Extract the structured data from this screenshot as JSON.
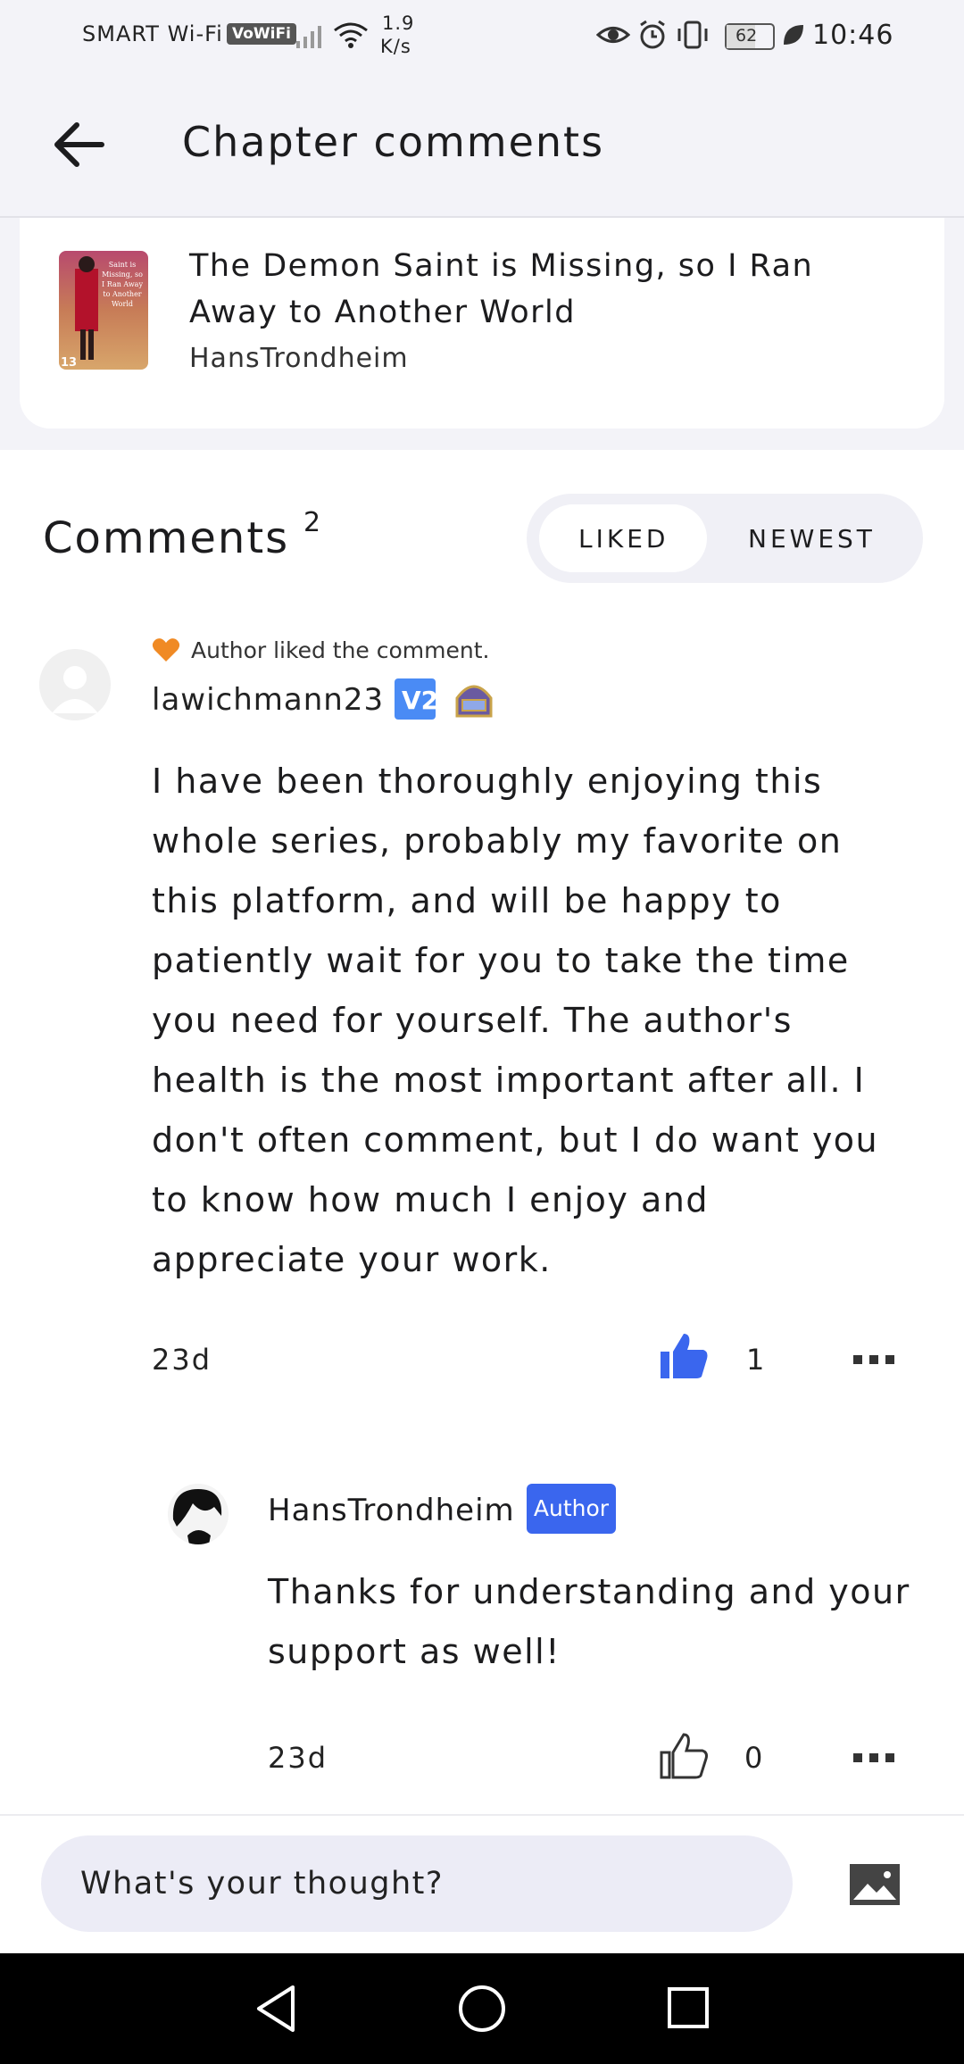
{
  "status_bar": {
    "carrier": "SMART Wi-Fi",
    "vowifi": "VoWiFi",
    "speed_value": "1.9",
    "speed_unit": "K/s",
    "battery": "62",
    "time": "10:46"
  },
  "header": {
    "title": "Chapter comments"
  },
  "book": {
    "title": "The Demon Saint is Missing, so I Ran Away to Another World",
    "author": "HansTrondheim",
    "cover_text": "Saint is Missing, so I Ran Away to Another World",
    "cover_number": "13"
  },
  "comments_section": {
    "title": "Comments",
    "count": "2",
    "sort_options": [
      "LIKED",
      "NEWEST"
    ],
    "selected_sort": "LIKED"
  },
  "comments": [
    {
      "liked_note": "Author liked the comment.",
      "username": "lawichmann23",
      "badge_v": "V2",
      "body": "I have been thoroughly enjoying this whole series, probably my favorite on this platform, and will be happy to patiently wait for you to take the time you need for yourself. The author's health is the most important after all. I don't often comment, but I do want you to know how much I enjoy and appreciate your work.",
      "age": "23d",
      "likes": "1",
      "liked": true,
      "reply": {
        "username": "HansTrondheim",
        "badge": "Author",
        "body": "Thanks for understanding and your support as well!",
        "age": "23d",
        "likes": "0",
        "liked": false
      }
    }
  ],
  "composer": {
    "placeholder": "What's your thought?"
  },
  "colors": {
    "accent": "#3a66ee",
    "heart": "#f08a24",
    "header_bg": "#f3f3f8"
  },
  "icons": [
    "back-arrow-icon",
    "heart-icon",
    "thumbs-up-icon",
    "more-icon",
    "image-icon",
    "nav-back-icon",
    "nav-home-icon",
    "nav-recents-icon"
  ]
}
